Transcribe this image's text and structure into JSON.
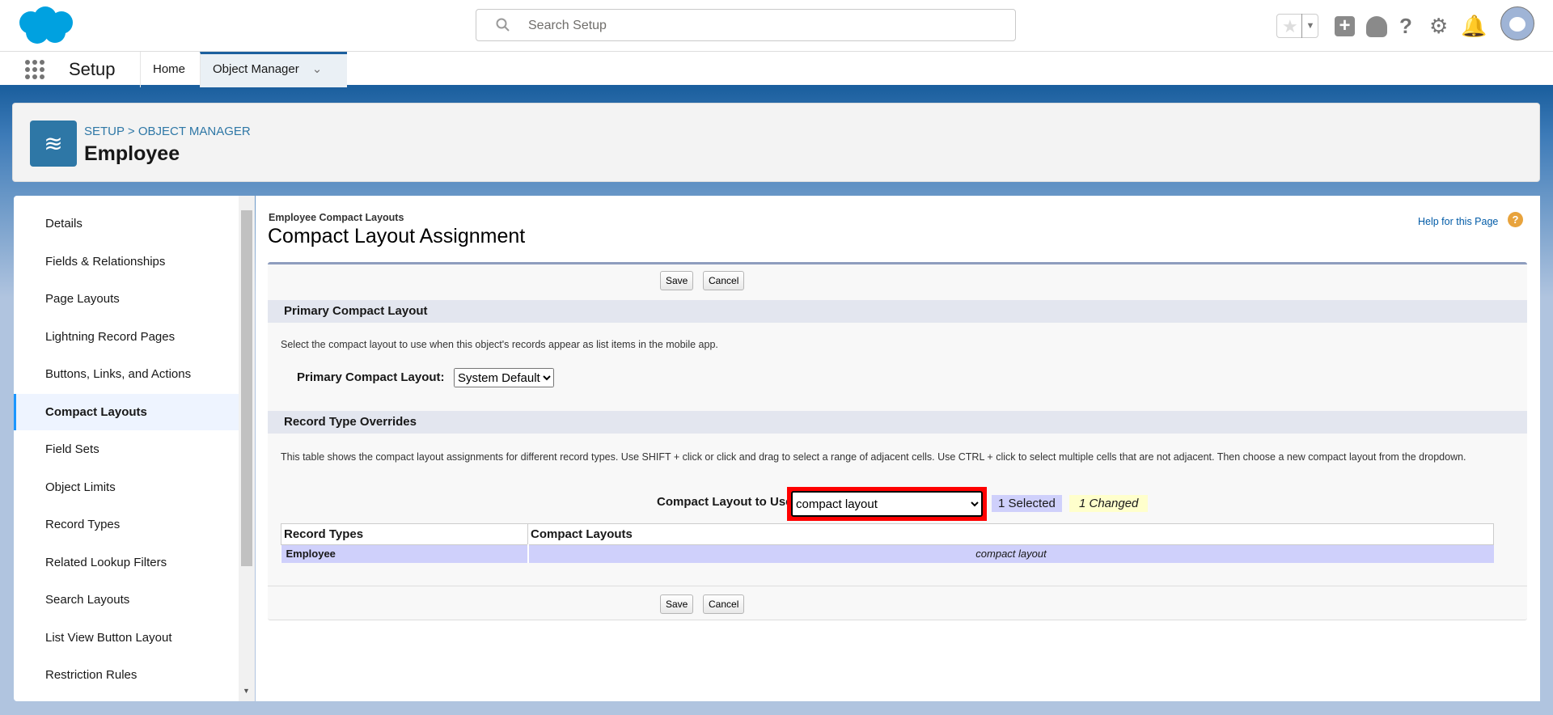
{
  "header": {
    "search_placeholder": "Search Setup",
    "icons": [
      "salesforce-cloud-logo",
      "favorites-star-icon",
      "add-icon",
      "trailhead-icon",
      "help-icon",
      "gear-icon",
      "bell-icon",
      "avatar"
    ]
  },
  "nav": {
    "app_name": "Setup",
    "tabs": [
      {
        "label": "Home"
      },
      {
        "label": "Object Manager",
        "active": true
      }
    ]
  },
  "object_header": {
    "breadcrumb": "SETUP > OBJECT MANAGER",
    "title": "Employee"
  },
  "sidebar": {
    "items": [
      {
        "label": "Details"
      },
      {
        "label": "Fields & Relationships"
      },
      {
        "label": "Page Layouts"
      },
      {
        "label": "Lightning Record Pages"
      },
      {
        "label": "Buttons, Links, and Actions"
      },
      {
        "label": "Compact Layouts",
        "active": true
      },
      {
        "label": "Field Sets"
      },
      {
        "label": "Object Limits"
      },
      {
        "label": "Record Types"
      },
      {
        "label": "Related Lookup Filters"
      },
      {
        "label": "Search Layouts"
      },
      {
        "label": "List View Button Layout"
      },
      {
        "label": "Restriction Rules"
      }
    ]
  },
  "content": {
    "subtitle": "Employee Compact Layouts",
    "title": "Compact Layout Assignment",
    "help_link": "Help for this Page",
    "save": "Save",
    "cancel": "Cancel",
    "primary_section": "Primary Compact Layout",
    "primary_desc": "Select the compact layout to use when this object's records appear as list items in the mobile app.",
    "primary_label": "Primary Compact Layout:",
    "primary_value": "System Default",
    "overrides_section": "Record Type Overrides",
    "overrides_desc": "This table shows the compact layout assignments for different record types. Use SHIFT + click or click and drag to select a range of adjacent cells. Use CTRL + click to select multiple cells that are not adjacent. Then choose a new compact layout from the dropdown.",
    "use_label": "Compact Layout to Use",
    "use_value": "compact layout",
    "selected_badge": "1 Selected",
    "changed_badge": "1 Changed",
    "table": {
      "headers": [
        "Record Types",
        "Compact Layouts"
      ],
      "rows": [
        [
          "Employee",
          "compact layout"
        ]
      ]
    }
  },
  "colors": {
    "brand": "#00a1e0",
    "nav_accent": "#1b5f9e",
    "highlight": "#ff0000",
    "selected_bg": "#cfd0fb",
    "changed_bg": "#ffffcc"
  }
}
